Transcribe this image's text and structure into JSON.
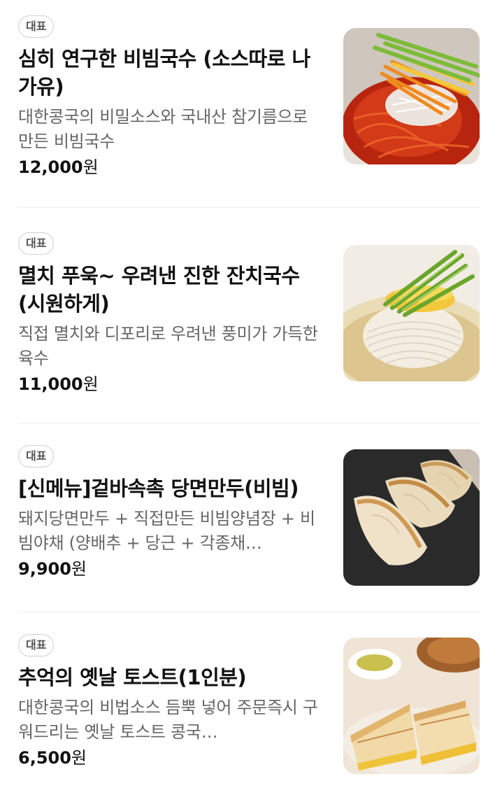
{
  "menu": {
    "items": [
      {
        "badge": "대표",
        "title": "심히 연구한 비빔국수 (소스따로 나가유)",
        "description": "대한콩국의 비밀소스와 국내산 참기름으로 만든 비빔국수",
        "price_number": "12,000",
        "price_unit": "원",
        "image": "spicy-bibim-noodles"
      },
      {
        "badge": "대표",
        "title": "멸치 푸욱~ 우려낸 진한 잔치국수 (시원하게)",
        "description": "직접 멸치와 디포리로 우려낸 풍미가 가득한 육수",
        "price_number": "11,000",
        "price_unit": "원",
        "image": "anchovy-broth-noodles"
      },
      {
        "badge": "대표",
        "title": "[신메뉴]겉바속촉 당면만두(비빔)",
        "description": "돼지당면만두 + 직접만든 비빔양념장 + 비빔야채 (양배추 + 당근 + 각종채…",
        "price_number": "9,900",
        "price_unit": "원",
        "image": "pan-fried-dumplings"
      },
      {
        "badge": "대표",
        "title": "추억의 옛날 토스트(1인분)",
        "description": "대한콩국의 비법소스 듬뿍 넣어 주문즉시 구워드리는 옛날 토스트 콩국…",
        "price_number": "6,500",
        "price_unit": "원",
        "image": "old-fashioned-toast"
      }
    ]
  }
}
